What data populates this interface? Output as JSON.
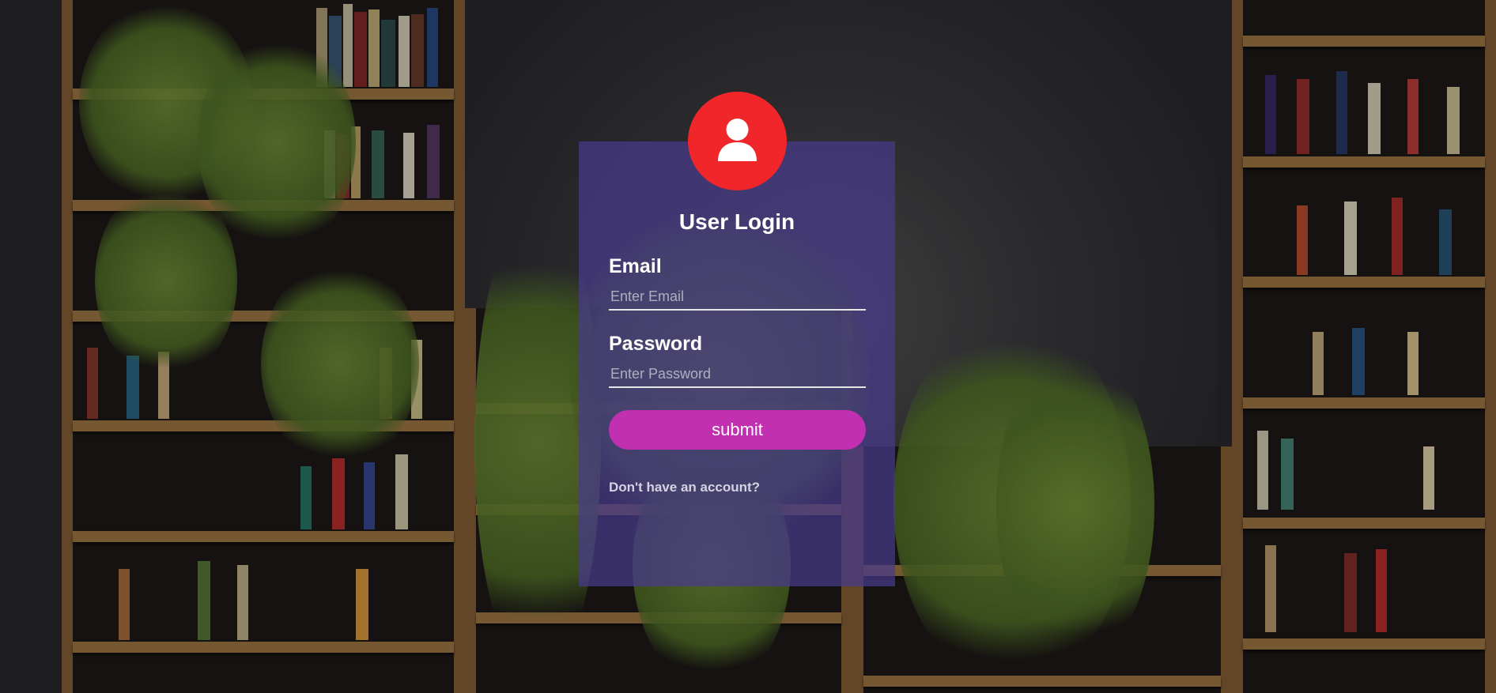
{
  "login": {
    "title": "User Login",
    "email_label": "Email",
    "email_placeholder": "Enter Email",
    "password_label": "Password",
    "password_placeholder": "Enter Password",
    "submit_label": "submit",
    "signup_link": "Don't have an account?"
  },
  "icons": {
    "avatar": "user-icon"
  },
  "colors": {
    "avatar_bg": "#f0262b",
    "card_bg": "#483a8c",
    "submit_bg": "#c030b0"
  }
}
